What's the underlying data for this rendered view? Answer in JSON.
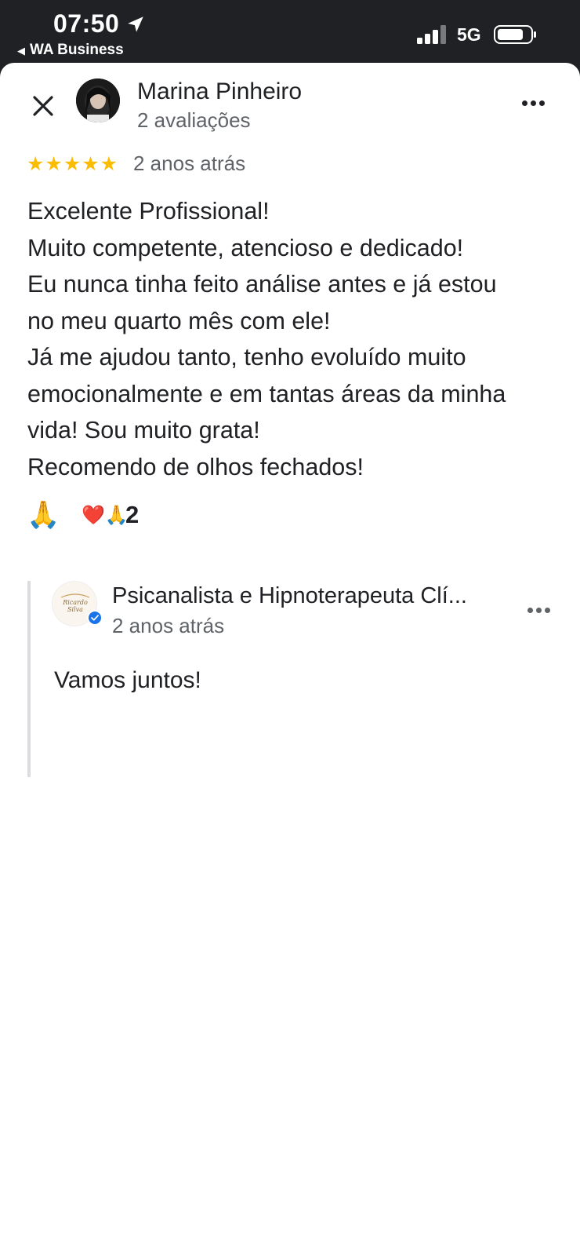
{
  "status_bar": {
    "time": "07:50",
    "back_app": "WA Business",
    "network": "5G"
  },
  "review": {
    "reviewer_name": "Marina Pinheiro",
    "reviewer_count": "2 avaliações",
    "rating": 5,
    "stars": "★★★★★",
    "date": "2 anos atrás",
    "text_lines": [
      "Excelente Profissional!",
      "Muito competente, atencioso e dedicado!",
      "Eu nunca tinha feito análise antes e já estou",
      "no meu quarto mês com ele!",
      "Já me ajudou tanto, tenho evoluído muito",
      "emocionalmente e em tantas áreas da minha",
      "vida! Sou muito grata!",
      "Recomendo de olhos fechados!"
    ],
    "reaction_button": "🙏",
    "reaction_summary": "❤️🙏",
    "reaction_count": "2"
  },
  "owner_reply": {
    "name": "Psicanalista e Hipnoterapeuta Clí...",
    "logo_text": "Ricardo Silva",
    "date": "2 anos atrás",
    "text": "Vamos juntos!"
  },
  "colors": {
    "star": "#fbbc04",
    "verified": "#1a73e8",
    "secondary_text": "#5f6368"
  },
  "icons": [
    "close-icon",
    "more-vert-icon",
    "location-arrow-icon",
    "signal-icon",
    "battery-icon",
    "verified-icon"
  ]
}
